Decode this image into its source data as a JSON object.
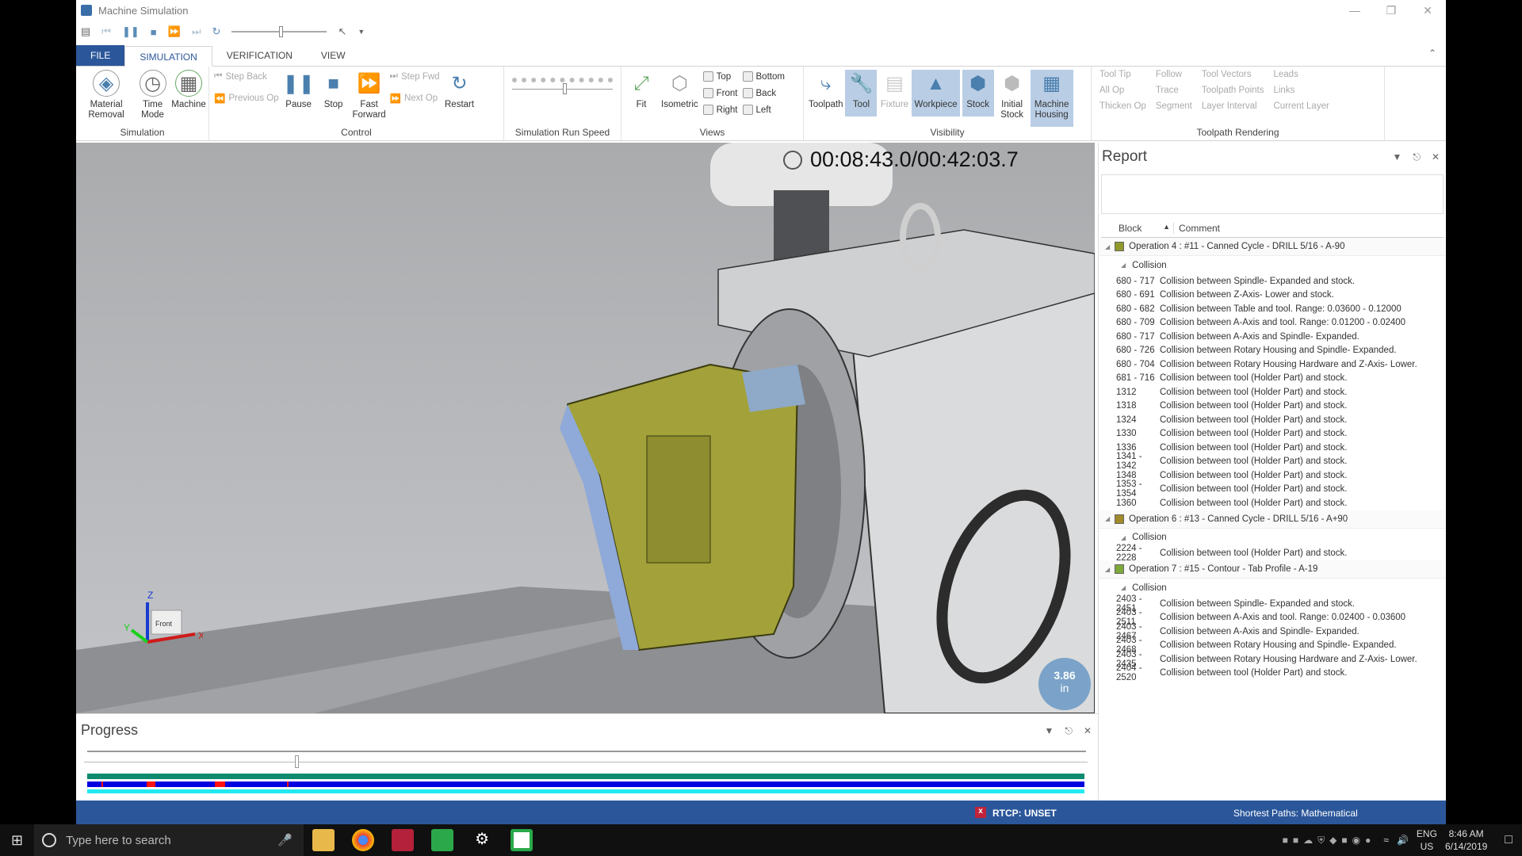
{
  "window": {
    "title": "Machine Simulation"
  },
  "tabs": [
    "FILE",
    "SIMULATION",
    "VERIFICATION",
    "VIEW"
  ],
  "ribbon": {
    "simulation": {
      "label": "Simulation",
      "buttons": [
        "Material Removal",
        "Time Mode",
        "Machine"
      ]
    },
    "control": {
      "label": "Control",
      "step_back": "Step Back",
      "previous_op": "Previous Op",
      "pause": "Pause",
      "stop": "Stop",
      "fast_forward": "Fast Forward",
      "step_fwd": "Step Fwd",
      "next_op": "Next Op",
      "restart": "Restart"
    },
    "speed": {
      "label": "Simulation Run Speed",
      "value_fraction": 0.5
    },
    "views": {
      "label": "Views",
      "fit": "Fit",
      "isometric": "Isometric",
      "top": "Top",
      "front": "Front",
      "right": "Right",
      "bottom": "Bottom",
      "back": "Back",
      "left": "Left"
    },
    "visibility": {
      "label": "Visibility",
      "toolpath": "Toolpath",
      "tool": "Tool",
      "fixture": "Fixture",
      "workpiece": "Workpiece",
      "stock": "Stock",
      "initial_stock": "Initial Stock",
      "machine_housing": "Machine Housing"
    },
    "rendering": {
      "label": "Toolpath Rendering",
      "items": [
        "Tool Tip",
        "All Op",
        "Thicken Op",
        "Follow",
        "Trace",
        "Segment",
        "Tool Vectors",
        "Toolpath Points",
        "Layer Interval",
        "Leads",
        "Links",
        "Current Layer"
      ]
    }
  },
  "viewport": {
    "timer": "00:08:43.0/00:42:03.7",
    "scale_value": "3.86",
    "scale_unit": "in",
    "axis_labels": {
      "x": "X",
      "y": "Y",
      "z": "Z",
      "cube": "Front"
    }
  },
  "report": {
    "title": "Report",
    "columns": {
      "block": "Block",
      "comment": "Comment"
    },
    "operations": [
      {
        "title": "Operation 4 : #11 - Canned Cycle - DRILL 5/16 - A-90",
        "color": "#8f9a2a",
        "group": "Collision",
        "rows": [
          [
            "680 - 717",
            "Collision between Spindle- Expanded and stock."
          ],
          [
            "680 - 691",
            "Collision between Z-Axis- Lower and stock."
          ],
          [
            "680 - 682",
            "Collision between Table and tool. Range: 0.03600 - 0.12000"
          ],
          [
            "680 - 709",
            "Collision between A-Axis and tool. Range: 0.01200 - 0.02400"
          ],
          [
            "680 - 717",
            "Collision between A-Axis and Spindle- Expanded."
          ],
          [
            "680 - 726",
            "Collision between Rotary Housing and Spindle- Expanded."
          ],
          [
            "680 - 704",
            "Collision between Rotary Housing Hardware and Z-Axis- Lower."
          ],
          [
            "681 - 716",
            "Collision between tool (Holder Part) and stock."
          ],
          [
            "1312",
            "Collision between tool (Holder Part) and stock."
          ],
          [
            "1318",
            "Collision between tool (Holder Part) and stock."
          ],
          [
            "1324",
            "Collision between tool (Holder Part) and stock."
          ],
          [
            "1330",
            "Collision between tool (Holder Part) and stock."
          ],
          [
            "1336",
            "Collision between tool (Holder Part) and stock."
          ],
          [
            "1341 - 1342",
            "Collision between tool (Holder Part) and stock."
          ],
          [
            "1348",
            "Collision between tool (Holder Part) and stock."
          ],
          [
            "1353 - 1354",
            "Collision between tool (Holder Part) and stock."
          ],
          [
            "1360",
            "Collision between tool (Holder Part) and stock."
          ]
        ]
      },
      {
        "title": "Operation 6 : #13 - Canned Cycle - DRILL 5/16 - A+90",
        "color": "#a08a2a",
        "group": "Collision",
        "rows": [
          [
            "2224 - 2228",
            "Collision between tool (Holder Part) and stock."
          ]
        ]
      },
      {
        "title": "Operation 7 : #15 - Contour - Tab Profile - A-19",
        "color": "#7fa83a",
        "group": "Collision",
        "rows": [
          [
            "2403 - 2451",
            "Collision between Spindle- Expanded and stock."
          ],
          [
            "2403 - 2511",
            "Collision between A-Axis and tool. Range: 0.02400 - 0.03600"
          ],
          [
            "2403 - 2467",
            "Collision between A-Axis and Spindle- Expanded."
          ],
          [
            "2403 - 2468",
            "Collision between Rotary Housing and Spindle- Expanded."
          ],
          [
            "2403 - 2435",
            "Collision between Rotary Housing Hardware and Z-Axis- Lower."
          ],
          [
            "2404 - 2520",
            "Collision between tool (Holder Part) and stock."
          ]
        ]
      }
    ]
  },
  "progress": {
    "title": "Progress",
    "position_fraction": 0.21
  },
  "status": {
    "rtcp": "RTCP: UNSET",
    "shortest_paths": "Shortest Paths: Mathematical"
  },
  "taskbar": {
    "search_placeholder": "Type here to search",
    "lang1": "ENG",
    "lang2": "US",
    "time": "8:46 AM",
    "date": "6/14/2019"
  },
  "colors": {
    "accent": "#2b579a",
    "progress_green": "#0e8a6e",
    "progress_blue": "#0000e0",
    "progress_cyan": "#22e8f0",
    "collision_red": "#ff1010"
  }
}
